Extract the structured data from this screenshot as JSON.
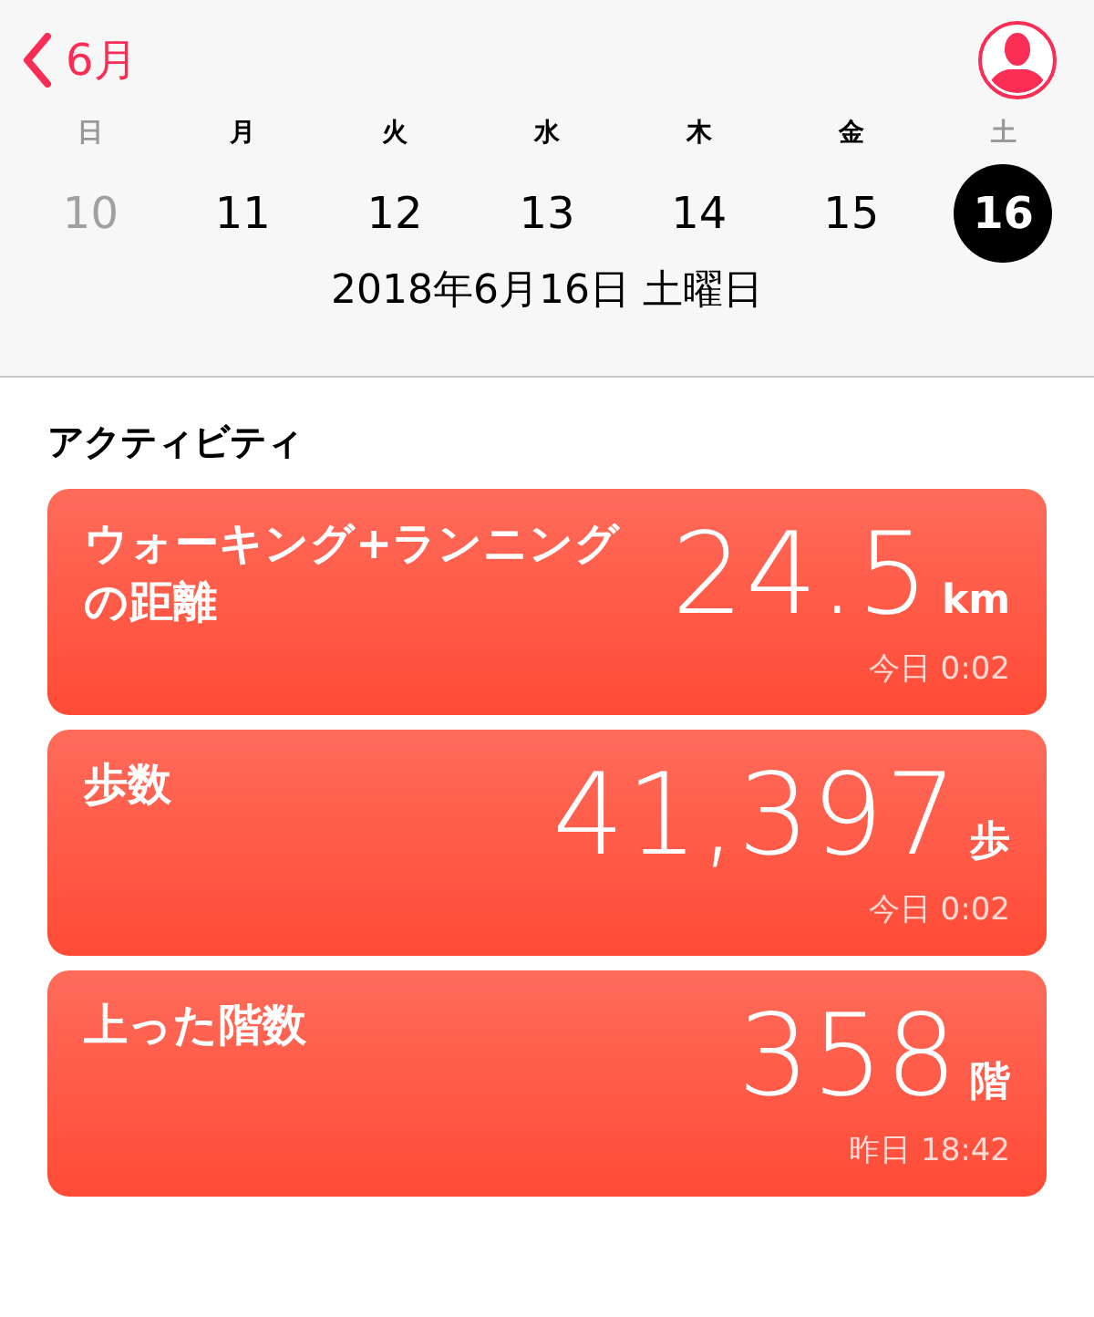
{
  "nav": {
    "back_label": "6月"
  },
  "week": [
    {
      "weekday": "日",
      "date": "10",
      "weekend": true,
      "dimmed": true,
      "selected": false
    },
    {
      "weekday": "月",
      "date": "11",
      "weekend": false,
      "dimmed": false,
      "selected": false
    },
    {
      "weekday": "火",
      "date": "12",
      "weekend": false,
      "dimmed": false,
      "selected": false
    },
    {
      "weekday": "水",
      "date": "13",
      "weekend": false,
      "dimmed": false,
      "selected": false
    },
    {
      "weekday": "木",
      "date": "14",
      "weekend": false,
      "dimmed": false,
      "selected": false
    },
    {
      "weekday": "金",
      "date": "15",
      "weekend": false,
      "dimmed": false,
      "selected": false
    },
    {
      "weekday": "土",
      "date": "16",
      "weekend": true,
      "dimmed": false,
      "selected": true
    }
  ],
  "selected_date": "2018年6月16日 土曜日",
  "section_title": "アクティビティ",
  "cards": [
    {
      "title": "ウォーキング+ランニングの距離",
      "value": "24.5",
      "unit": "km",
      "time": "今日 0:02"
    },
    {
      "title": "歩数",
      "value": "41,397",
      "unit": "歩",
      "time": "今日 0:02"
    },
    {
      "title": "上った階数",
      "value": "358",
      "unit": "階",
      "time": "昨日 18:42"
    }
  ]
}
